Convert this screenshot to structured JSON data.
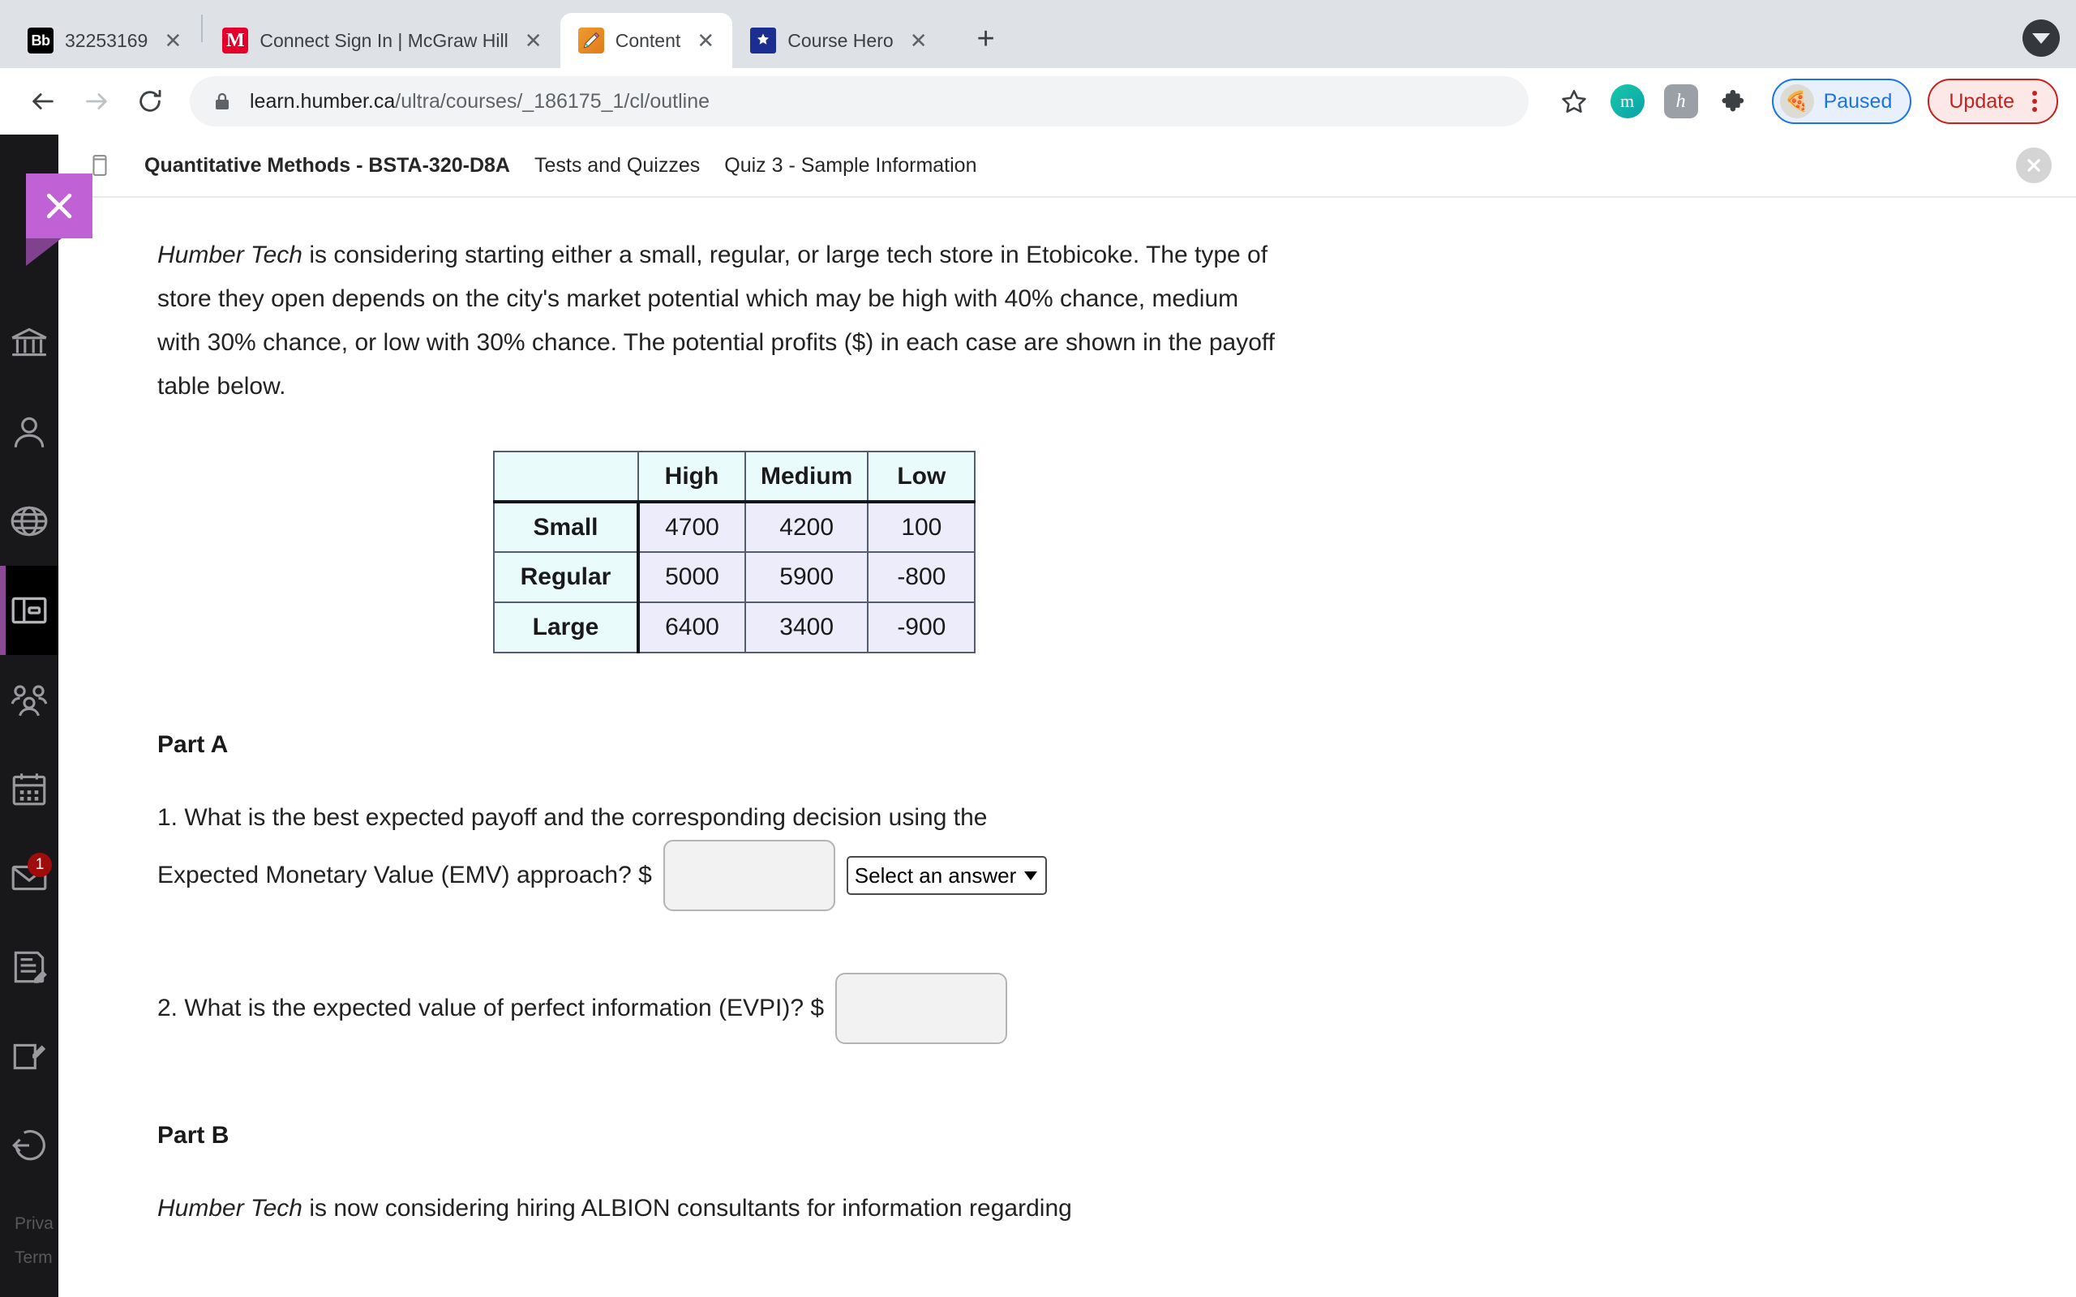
{
  "browser": {
    "tabs": [
      {
        "title": "32253169",
        "favicon": "blackboard-icon",
        "favicon_text": "Bb",
        "active": false,
        "has_close": true
      },
      {
        "title": "Connect Sign In | McGraw Hill",
        "favicon": "mcgrawhill-icon",
        "favicon_text": "M",
        "active": false,
        "has_close": true
      },
      {
        "title": "Content",
        "favicon": "pencil-icon",
        "favicon_text": "",
        "active": true,
        "has_close": true
      },
      {
        "title": "Course Hero",
        "favicon": "coursehero-icon",
        "favicon_text": "",
        "active": false,
        "has_close": true
      }
    ],
    "new_tab_label": "+",
    "url": {
      "domain": "learn.humber.ca",
      "path": "/ultra/courses/_186175_1/cl/outline",
      "full": "learn.humber.ca/ultra/courses/_186175_1/cl/outline"
    },
    "extensions": {
      "profile_letter": "m",
      "honey_letter": "h",
      "paused_label": "Paused",
      "update_label": "Update"
    },
    "accents": {
      "paused_blue": "#1a73e8",
      "update_red": "#c5221f",
      "tabstrip_bg": "#dee1e6",
      "omnibox_bg": "#f1f3f4"
    }
  },
  "rail": {
    "close_label": "Close menu",
    "items": [
      {
        "name": "institution-icon",
        "label": "Institution Page",
        "active": false,
        "badge": ""
      },
      {
        "name": "profile-icon",
        "label": "Profile",
        "active": false,
        "badge": ""
      },
      {
        "name": "globe-icon",
        "label": "Activity Stream",
        "active": false,
        "badge": ""
      },
      {
        "name": "courses-icon",
        "label": "Courses",
        "active": true,
        "badge": ""
      },
      {
        "name": "groups-icon",
        "label": "Organizations",
        "active": false,
        "badge": ""
      },
      {
        "name": "calendar-icon",
        "label": "Calendar",
        "active": false,
        "badge": ""
      },
      {
        "name": "messages-icon",
        "label": "Messages",
        "active": false,
        "badge": "1"
      },
      {
        "name": "grades-icon",
        "label": "Grades",
        "active": false,
        "badge": ""
      },
      {
        "name": "tools-icon",
        "label": "Tools",
        "active": false,
        "badge": ""
      },
      {
        "name": "signout-icon",
        "label": "Sign Out",
        "active": false,
        "badge": ""
      }
    ],
    "footer": {
      "privacy": "Priva",
      "terms": "Term"
    }
  },
  "breadcrumb": {
    "course": "Quantitative Methods - BSTA-320-D8A",
    "section": "Tests and Quizzes",
    "item": "Quiz 3 - Sample Information"
  },
  "question": {
    "intro_italic": "Humber Tech",
    "intro_rest": " is considering starting either a small, regular, or large tech store in Etobicoke. The type of store they open depends on the city's market potential which may be high with 40% chance, medium with 30% chance, or low with 30% chance. The potential profits ($) in each case are shown in the payoff table below.",
    "part_a_heading": "Part A",
    "q1_line1": "1. What is the best expected payoff and the corresponding decision using the",
    "q1_line2": "Expected Monetary Value (EMV) approach? $",
    "q1_input_value": "",
    "q1_select_value": "Select an answer",
    "q2_text": "2. What is the expected value of perfect information (EVPI)? $",
    "q2_input_value": "",
    "part_b_heading": "Part B",
    "part_b_italic": "Humber Tech",
    "part_b_rest": " is now considering hiring ALBION consultants for information regarding"
  },
  "chart_data": {
    "type": "table",
    "title": "Payoff table",
    "corner_label": "",
    "categories": [
      "High",
      "Medium",
      "Low"
    ],
    "rows": [
      {
        "name": "Small",
        "values": [
          "4700",
          "4200",
          "100"
        ]
      },
      {
        "name": "Regular",
        "values": [
          "5000",
          "5900",
          "-800"
        ]
      },
      {
        "name": "Large",
        "values": [
          "6400",
          "3400",
          "-900"
        ]
      }
    ],
    "probabilities": {
      "High": 0.4,
      "Medium": 0.3,
      "Low": 0.3
    },
    "header_bg": "#e9fbfa",
    "cell_bg": "#ececfa",
    "border_color": "#555c6e"
  }
}
